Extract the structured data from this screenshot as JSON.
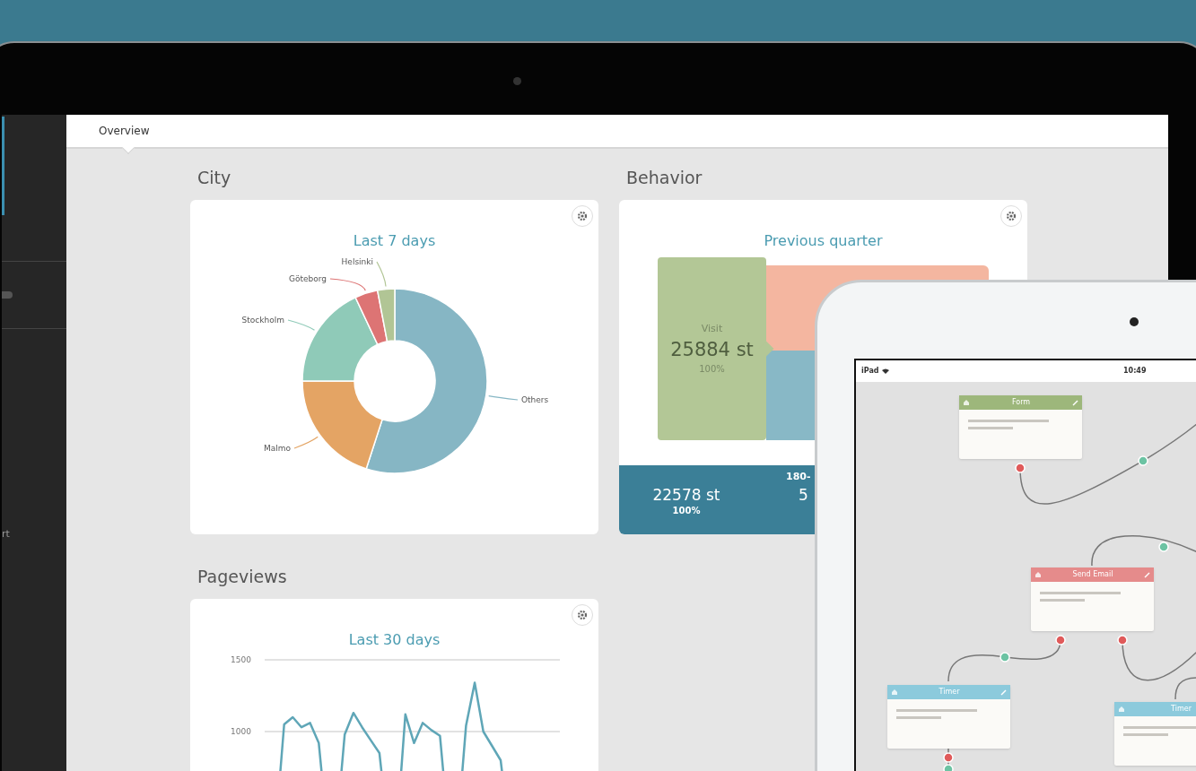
{
  "laptop": {
    "sidebar": {
      "footer_label": "rt"
    },
    "tabs": [
      {
        "label": "Overview",
        "selected": true
      }
    ],
    "city": {
      "heading": "City",
      "subtitle": "Last 7 days",
      "chart_data": {
        "type": "donut",
        "categories": [
          "Others",
          "Malmo",
          "Stockholm",
          "Göteborg",
          "Helsinki"
        ],
        "values": [
          55,
          20,
          18,
          4,
          3
        ]
      }
    },
    "behavior": {
      "heading": "Behavior",
      "subtitle": "Previous quarter",
      "source": {
        "label": "Visit",
        "value": "25884 st",
        "share": "100%",
        "color": "#b3c796"
      },
      "flows": [
        {
          "color": "#f4b6a0"
        },
        {
          "color": "#88b8c6"
        }
      ],
      "footer": {
        "label": "180-",
        "columns": [
          {
            "value": "22578 st",
            "share": "100%"
          },
          {
            "value": "5"
          }
        ]
      }
    },
    "pageviews": {
      "heading": "Pageviews",
      "subtitle": "Last 30 days",
      "tick_labels": [
        "1500",
        "1000"
      ]
    }
  },
  "tablet": {
    "status_bar": {
      "carrier": "iPad",
      "time": "10:49"
    },
    "nodes": [
      {
        "title": "Form",
        "color": "#9db77b"
      },
      {
        "title": "Send Email",
        "color": "#e58b8b"
      },
      {
        "title": "Timer",
        "color": "#8ccadc"
      },
      {
        "title": "Timer",
        "color": "#8ccadc"
      }
    ]
  }
}
